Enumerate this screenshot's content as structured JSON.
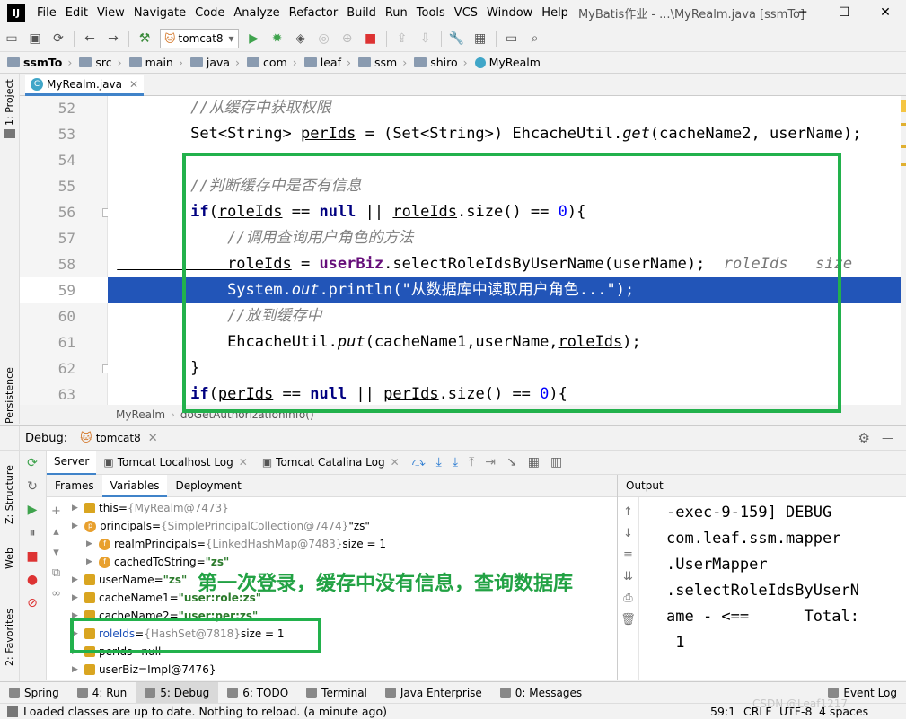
{
  "app": {
    "logo": "IJ",
    "menu": [
      "File",
      "Edit",
      "View",
      "Navigate",
      "Code",
      "Analyze",
      "Refactor",
      "Build",
      "Run",
      "Tools",
      "VCS",
      "Window",
      "Help"
    ],
    "window_title": "MyBatis作业 - ...\\MyRealm.java [ssmTo]",
    "run_config": "tomcat8"
  },
  "breadcrumbs": [
    "ssmTo",
    "src",
    "main",
    "java",
    "com",
    "leaf",
    "ssm",
    "shiro",
    "MyRealm"
  ],
  "left_tools": {
    "project": "1: Project",
    "persistence": "Persistence",
    "structure": "Z: Structure",
    "web": "Web",
    "favorites": "2: Favorites"
  },
  "editor": {
    "tab": "MyRealm.java",
    "lines": [
      {
        "n": "52",
        "segs": [
          {
            "c": "cm",
            "t": "        //从缓存中获取权限"
          }
        ]
      },
      {
        "n": "53",
        "segs": [
          {
            "c": "",
            "t": "        Set<String> "
          },
          {
            "c": "ul",
            "t": "perIds"
          },
          {
            "c": "",
            "t": " = (Set<String>) EhcacheUtil."
          },
          {
            "c": "it",
            "t": "get"
          },
          {
            "c": "",
            "t": "(cacheName2, userName);"
          }
        ]
      },
      {
        "n": "54",
        "segs": []
      },
      {
        "n": "55",
        "segs": [
          {
            "c": "cm",
            "t": "        //判断缓存中是否有信息"
          }
        ]
      },
      {
        "n": "56",
        "segs": [
          {
            "c": "kw",
            "t": "        if"
          },
          {
            "c": "",
            "t": "("
          },
          {
            "c": "ul",
            "t": "roleIds"
          },
          {
            "c": "",
            "t": " == "
          },
          {
            "c": "kw",
            "t": "null"
          },
          {
            "c": "",
            "t": " || "
          },
          {
            "c": "ul",
            "t": "roleIds"
          },
          {
            "c": "",
            "t": ".size() == "
          },
          {
            "c": "num",
            "t": "0"
          },
          {
            "c": "",
            "t": "){"
          }
        ]
      },
      {
        "n": "57",
        "segs": [
          {
            "c": "cm",
            "t": "            //调用查询用户角色的方法"
          }
        ]
      },
      {
        "n": "58",
        "segs": [
          {
            "c": "ul",
            "t": "            roleIds"
          },
          {
            "c": "",
            "t": " = "
          },
          {
            "c": "fld",
            "t": "userBiz"
          },
          {
            "c": "",
            "t": ".selectRoleIdsByUserName(userName);  "
          },
          {
            "c": "hint",
            "t": "roleIds   size"
          }
        ]
      },
      {
        "n": "59",
        "segs": [
          {
            "c": "",
            "t": "            System."
          },
          {
            "c": "it",
            "t": "out"
          },
          {
            "c": "",
            "t": ".println(\"从数据库中读取用户角色...\");"
          }
        ]
      },
      {
        "n": "60",
        "segs": [
          {
            "c": "cm",
            "t": "            //放到缓存中"
          }
        ]
      },
      {
        "n": "61",
        "segs": [
          {
            "c": "",
            "t": "            EhcacheUtil."
          },
          {
            "c": "it",
            "t": "put"
          },
          {
            "c": "",
            "t": "(cacheName1,userName,"
          },
          {
            "c": "ul",
            "t": "roleIds"
          },
          {
            "c": "",
            "t": ");"
          }
        ]
      },
      {
        "n": "62",
        "segs": [
          {
            "c": "",
            "t": "        }"
          }
        ]
      },
      {
        "n": "63",
        "segs": [
          {
            "c": "kw",
            "t": "        if"
          },
          {
            "c": "",
            "t": "("
          },
          {
            "c": "ul",
            "t": "perIds"
          },
          {
            "c": "",
            "t": " == "
          },
          {
            "c": "kw",
            "t": "null"
          },
          {
            "c": "",
            "t": " || "
          },
          {
            "c": "ul",
            "t": "perIds"
          },
          {
            "c": "",
            "t": ".size() == "
          },
          {
            "c": "num",
            "t": "0"
          },
          {
            "c": "",
            "t": "){"
          }
        ]
      }
    ],
    "highlighted_line": "59",
    "footer": {
      "class": "MyRealm",
      "method": "doGetAuthorizationInfo()"
    }
  },
  "debug": {
    "label": "Debug:",
    "session": "tomcat8",
    "tabs": [
      "Server",
      "Tomcat Localhost Log",
      "Tomcat Catalina Log"
    ],
    "subtabs": [
      "Frames",
      "Variables",
      "Deployment"
    ],
    "output_title": "Output",
    "variables": [
      {
        "indent": 0,
        "icon": "field",
        "name": "this",
        "eq": " = ",
        "val": "{MyRealm@7473}",
        "extra": ""
      },
      {
        "indent": 0,
        "icon": "p",
        "name": "principals",
        "eq": " = ",
        "val": "{SimplePrincipalCollection@7474}",
        "extra": " \"zs\""
      },
      {
        "indent": 1,
        "icon": "f",
        "name": "realmPrincipals",
        "eq": " = ",
        "val": "{LinkedHashMap@7483}",
        "extra": "  size = 1"
      },
      {
        "indent": 1,
        "icon": "f",
        "name": "cachedToString",
        "eq": " = ",
        "val": "",
        "extra": "\"zs\""
      },
      {
        "indent": 0,
        "icon": "field",
        "name": "userName",
        "eq": " = ",
        "val": "",
        "extra": "\"zs\""
      },
      {
        "indent": 0,
        "icon": "field",
        "name": "cacheName1",
        "eq": " = ",
        "val": "",
        "extra": "\"user:role:zs\""
      },
      {
        "indent": 0,
        "icon": "field",
        "name": "cacheName2",
        "eq": " = ",
        "val": "",
        "extra": "\"user:per:zs\""
      },
      {
        "indent": 0,
        "icon": "field",
        "name": "roleIds",
        "eq": " = ",
        "val": "{HashSet@7818}",
        "extra": "  size = 1"
      },
      {
        "indent": 0,
        "icon": "field",
        "name": "perIds",
        "eq": " = ",
        "val": "",
        "extra": "null"
      },
      {
        "indent": 0,
        "icon": "field",
        "name": "userBiz",
        "eq": " = ",
        "val": "",
        "extra": "Impl@7476}"
      }
    ],
    "output_lines": [
      "-exec-9-159] DEBUG",
      "com.leaf.ssm.mapper",
      ".UserMapper",
      ".selectRoleIdsByUserN",
      "ame - <==      Total:",
      " 1"
    ],
    "annotation": "第一次登录，缓存中没有信息，查询数据库"
  },
  "bottom_tabs": [
    {
      "label": "Spring",
      "key": ""
    },
    {
      "label": "4: Run",
      "key": "4"
    },
    {
      "label": "5: Debug",
      "key": "5"
    },
    {
      "label": "6: TODO",
      "key": "6"
    },
    {
      "label": "Terminal",
      "key": ""
    },
    {
      "label": "Java Enterprise",
      "key": ""
    },
    {
      "label": "0: Messages",
      "key": "0"
    }
  ],
  "event_log": "Event Log",
  "status": {
    "message": "Loaded classes are up to date. Nothing to reload. (a minute ago)",
    "position": "59:1",
    "line_sep": "CRLF",
    "encoding": "UTF-8",
    "indent": "4 spaces"
  },
  "watermark": "CSDN @Leaf1217",
  "colors": {
    "highlight": "#2255b8",
    "green_box": "#22b14c",
    "annotation": "#22a244"
  }
}
